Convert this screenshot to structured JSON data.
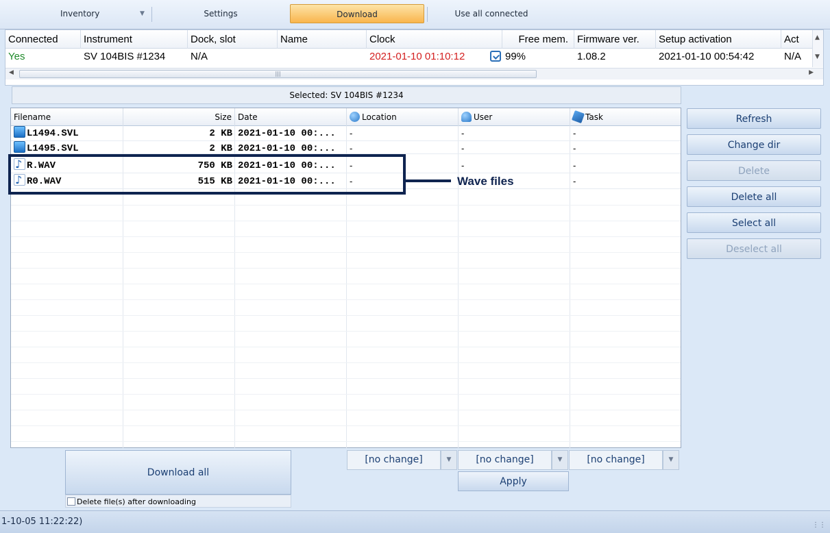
{
  "toolbar": {
    "inventory": "Inventory",
    "settings": "Settings",
    "download": "Download",
    "use_all": "Use all connected"
  },
  "instruments": {
    "columns": [
      "Connected",
      "Instrument",
      "Dock, slot",
      "Name",
      "Clock",
      "Free mem.",
      "Firmware ver.",
      "Setup activation",
      "Act"
    ],
    "row": {
      "connected": "Yes",
      "instrument": "SV 104BIS #1234",
      "dock": "N/A",
      "name": "",
      "clock": "2021-01-10 01:10:12",
      "free_mem": "99%",
      "firmware": "1.08.2",
      "setup_activation": "2021-01-10 00:54:42",
      "act": "N/A"
    },
    "connected_color": "#1f8a2a",
    "clock_color": "#d42020"
  },
  "selected_banner": "Selected: SV 104BIS #1234",
  "files": {
    "columns": {
      "filename": "Filename",
      "size": "Size",
      "date": "Date",
      "location": "Location",
      "user": "User",
      "task": "Task"
    },
    "rows": [
      {
        "icon": "svl-file-icon",
        "name": "L1494.SVL",
        "size": "2 KB",
        "date": "2021-01-10 00:...",
        "location": "-",
        "user": "-",
        "task": "-"
      },
      {
        "icon": "svl-file-icon",
        "name": "L1495.SVL",
        "size": "2 KB",
        "date": "2021-01-10 00:...",
        "location": "-",
        "user": "-",
        "task": "-"
      },
      {
        "icon": "music-note-icon",
        "name": "R.WAV",
        "size": "750 KB",
        "date": "2021-01-10 00:...",
        "location": "-",
        "user": "-",
        "task": "-"
      },
      {
        "icon": "music-note-icon",
        "name": "R0.WAV",
        "size": "515 KB",
        "date": "2021-01-10 00:...",
        "location": "-",
        "user": "",
        "task": "-"
      }
    ]
  },
  "annotation": "Wave files",
  "actions": {
    "refresh": "Refresh",
    "change_dir": "Change dir",
    "delete": "Delete",
    "delete_all": "Delete all",
    "select_all": "Select all",
    "deselect_all": "Deselect all"
  },
  "bottom": {
    "download_all": "Download all",
    "delete_after": "Delete file(s) after downloading",
    "combo_location": "[no change]",
    "combo_user": "[no change]",
    "combo_task": "[no change]",
    "apply": "Apply"
  },
  "status_text": "1-10-05 11:22:22)"
}
